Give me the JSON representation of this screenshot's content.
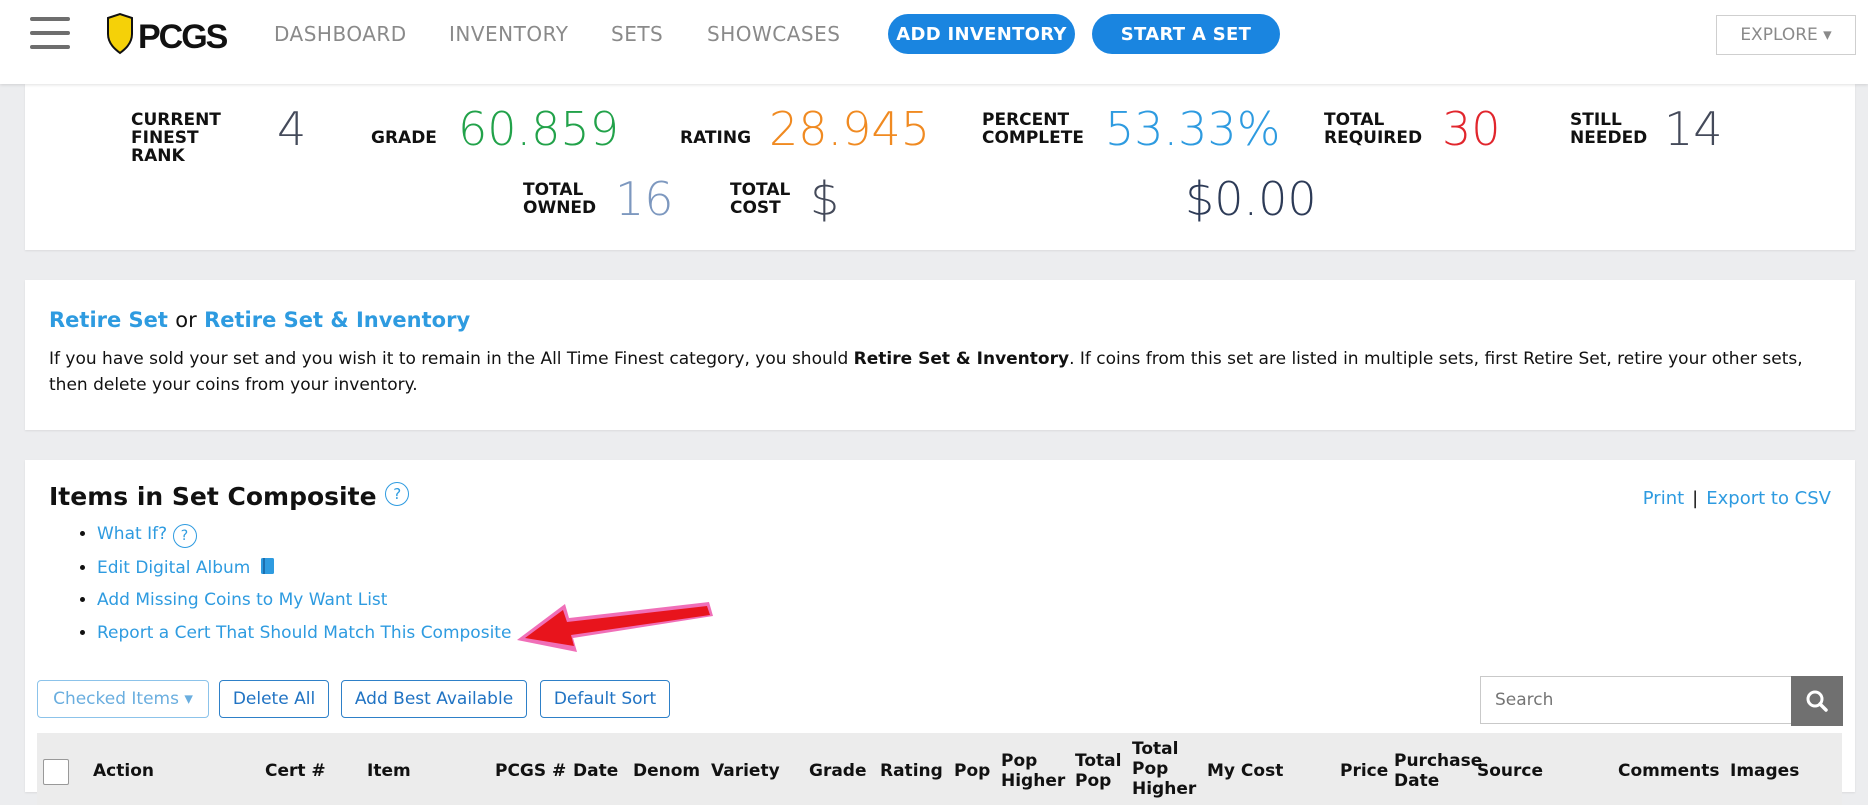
{
  "header": {
    "logo_text": "PCGS",
    "nav": [
      "DASHBOARD",
      "INVENTORY",
      "SETS",
      "SHOWCASES"
    ],
    "add_inventory": "ADD INVENTORY",
    "start_set": "START A SET",
    "explore": "EXPLORE ▾"
  },
  "stats": {
    "finest_rank_label": "CURRENT FINEST RANK",
    "finest_rank": "4",
    "grade_label": "GRADE",
    "grade": "60.859",
    "rating_label": "RATING",
    "rating": "28.945",
    "percent_label": "PERCENT COMPLETE",
    "percent": "53.33%",
    "total_required_label": "TOTAL REQUIRED",
    "total_required": "30",
    "still_needed_label": "STILL NEEDED",
    "still_needed": "14",
    "total_owned_label": "TOTAL OWNED",
    "total_owned": "16",
    "total_cost_label": "TOTAL COST",
    "dollar_sign": "$",
    "total_cost": "$0.00",
    "colors": {
      "grade": "#22a24a",
      "rating": "#f08a21",
      "percent": "#2e9be0",
      "required": "#e1262d",
      "neutral": "#444a5a"
    }
  },
  "retire": {
    "retire_set": "Retire Set",
    "or": "or",
    "retire_set_inventory": "Retire Set & Inventory",
    "text_before": "If you have sold your set and you wish it to remain in the All Time Finest category, you should ",
    "text_bold": "Retire Set & Inventory",
    "text_after": ". If coins from this set are listed in multiple sets, first Retire Set, retire your other sets, then delete your coins from your inventory."
  },
  "items": {
    "title": "Items in Set Composite",
    "help": "?",
    "print": "Print",
    "separator": "|",
    "export": "Export to CSV",
    "actions": [
      "What If?",
      "Edit Digital Album",
      "Add Missing Coins to My Want List",
      "Report a Cert That Should Match This Composite"
    ],
    "checked_items": "Checked Items ▾",
    "delete_all": "Delete All",
    "add_best": "Add Best Available",
    "default_sort": "Default Sort",
    "search_placeholder": "Search",
    "columns": [
      "Action",
      "Cert #",
      "Item",
      "PCGS #",
      "Date",
      "Denom",
      "Variety",
      "Grade",
      "Rating",
      "Pop",
      "Pop Higher",
      "Total Pop",
      "Total Pop Higher",
      "My Cost",
      "Price",
      "Purchase Date",
      "Source",
      "Comments",
      "Images"
    ]
  }
}
